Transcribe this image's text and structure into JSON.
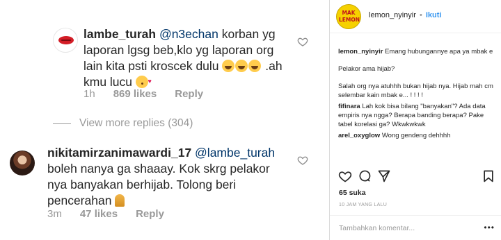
{
  "comments": [
    {
      "username": "lambe_turah",
      "mention": "@n3echan",
      "text_part1": " korban yg laporan lgsg beb,klo yg laporan org lain kita psti kroscek dulu ",
      "text_part2": " .ah kmu lucu ",
      "time": "1h",
      "likes": "869 likes",
      "reply": "Reply"
    },
    {
      "username": "nikitamirzanimawardi_17",
      "mention": "@lambe_turah",
      "text_part1": " boleh nanya ga shaaay. Kok skrg pelakor nya banyakan berhijab. Tolong beri pencerahan ",
      "time": "3m",
      "likes": "47 likes",
      "reply": "Reply"
    }
  ],
  "view_more": "View more replies (304)",
  "post": {
    "account": "lemon_nyinyir",
    "separator": "•",
    "follow_label": "Ikuti",
    "avatar_text": "MAK LEMON",
    "caption_user": "lemon_nyinyir",
    "caption_line1": "Emang hubungannye apa ya mbak e",
    "caption_line2": "Pelakor ama hijab?",
    "caption_line3": "Salah org nya atuhhh bukan hijab nya. Hijab mah cm selembar kain mbak e... ! ! ! !",
    "replies": [
      {
        "user": "fifinara",
        "text": "Lah kok bisa bilang \"banyakan\"? Ada data empiris nya ngga? Berapa banding berapa? Pake tabel korelasi ga? Wkwkwkwk"
      },
      {
        "user": "arel_oxyglow",
        "text": "Wong gendeng dehhhh"
      }
    ],
    "likes": "65 suka",
    "time": "10 JAM YANG LALU",
    "comment_placeholder": "Tambahkan komentar...",
    "more": "•••"
  },
  "icons": {
    "heart": "heart-icon",
    "comment": "comment-icon",
    "share": "share-icon",
    "bookmark": "bookmark-icon"
  }
}
